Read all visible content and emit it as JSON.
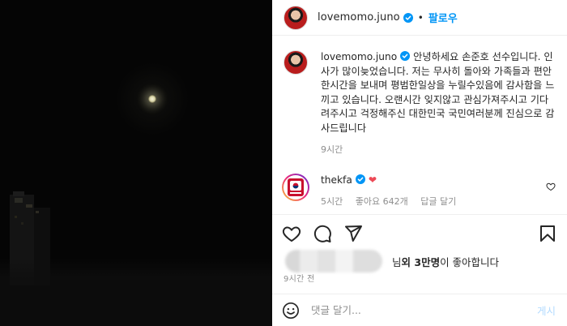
{
  "post": {
    "author": "lovemomo.juno",
    "dot": "•",
    "follow_label": "팔로우"
  },
  "caption": {
    "author": "lovemomo.juno",
    "text": "안녕하세요 손준호 선수입니다. 인사가 많이늦었습니다. 저는 무사히 돌아와 가족들과 편안한시간을 보내며 평범한일상을 누릴수있음에 감사함을 느끼고 있습니다. 오랜시간 잊지않고 관심가져주시고 기다려주시고 걱정해주신 대한민국 국민여러분께 진심으로 감사드립니다",
    "time": "9시간"
  },
  "comment": {
    "author": "thekfa",
    "heart": "❤",
    "time": "5시간",
    "likes": "좋아요 642개",
    "reply": "답글 달기"
  },
  "likes": {
    "prefix": "님 ",
    "bold": "외 3만명",
    "suffix": "이 좋아합니다"
  },
  "post_time": "9시간 전",
  "composer": {
    "placeholder": "댓글 달기...",
    "post_label": "게시"
  },
  "colors": {
    "accent": "#0095f6",
    "heart": "#ed4956",
    "text": "#262626",
    "muted": "#8e8e8e"
  },
  "icons": [
    "heart-icon",
    "comment-icon",
    "share-icon",
    "save-icon",
    "emoji-icon",
    "verified-icon"
  ]
}
